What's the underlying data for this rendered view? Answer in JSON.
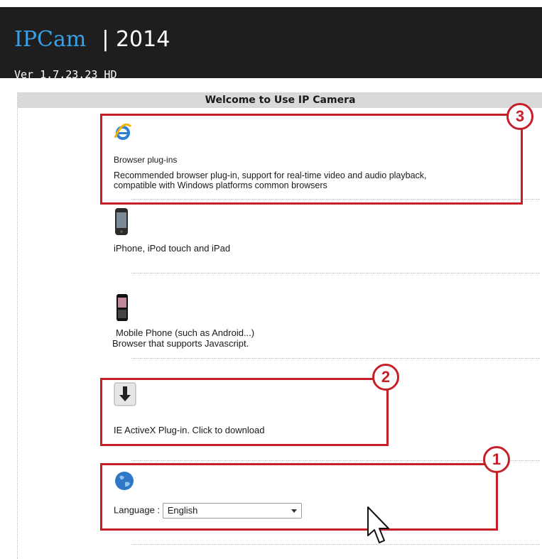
{
  "header": {
    "logo": "IPCam",
    "year": "| 2014",
    "version": "Ver  1.7.23.23 HD"
  },
  "page_title": "Welcome to Use IP Camera",
  "sections": {
    "browser": {
      "title": "Browser plug-ins",
      "desc1": "Recommended browser plug-in, support for real-time video and audio playback,",
      "desc2": "compatible with Windows platforms common browsers",
      "icon": "internet-explorer-icon"
    },
    "iphone": {
      "title": "iPhone, iPod touch and iPad",
      "icon": "iphone-icon"
    },
    "mobile": {
      "title": "Mobile Phone (such as Android...)",
      "desc": "Browser that supports Javascript.",
      "icon": "android-phone-icon"
    },
    "activex": {
      "title": "IE ActiveX Plug-in. Click to download",
      "icon": "download-icon"
    },
    "language": {
      "label": "Language :",
      "value": "English",
      "icon": "globe-icon"
    }
  },
  "annotations": {
    "one": "1",
    "two": "2",
    "three": "3"
  },
  "colors": {
    "annotation": "#c51f28",
    "header_bg": "#d9d9d9",
    "topbar_bg": "#1e1e1e",
    "logo": "#3aa0e6"
  }
}
